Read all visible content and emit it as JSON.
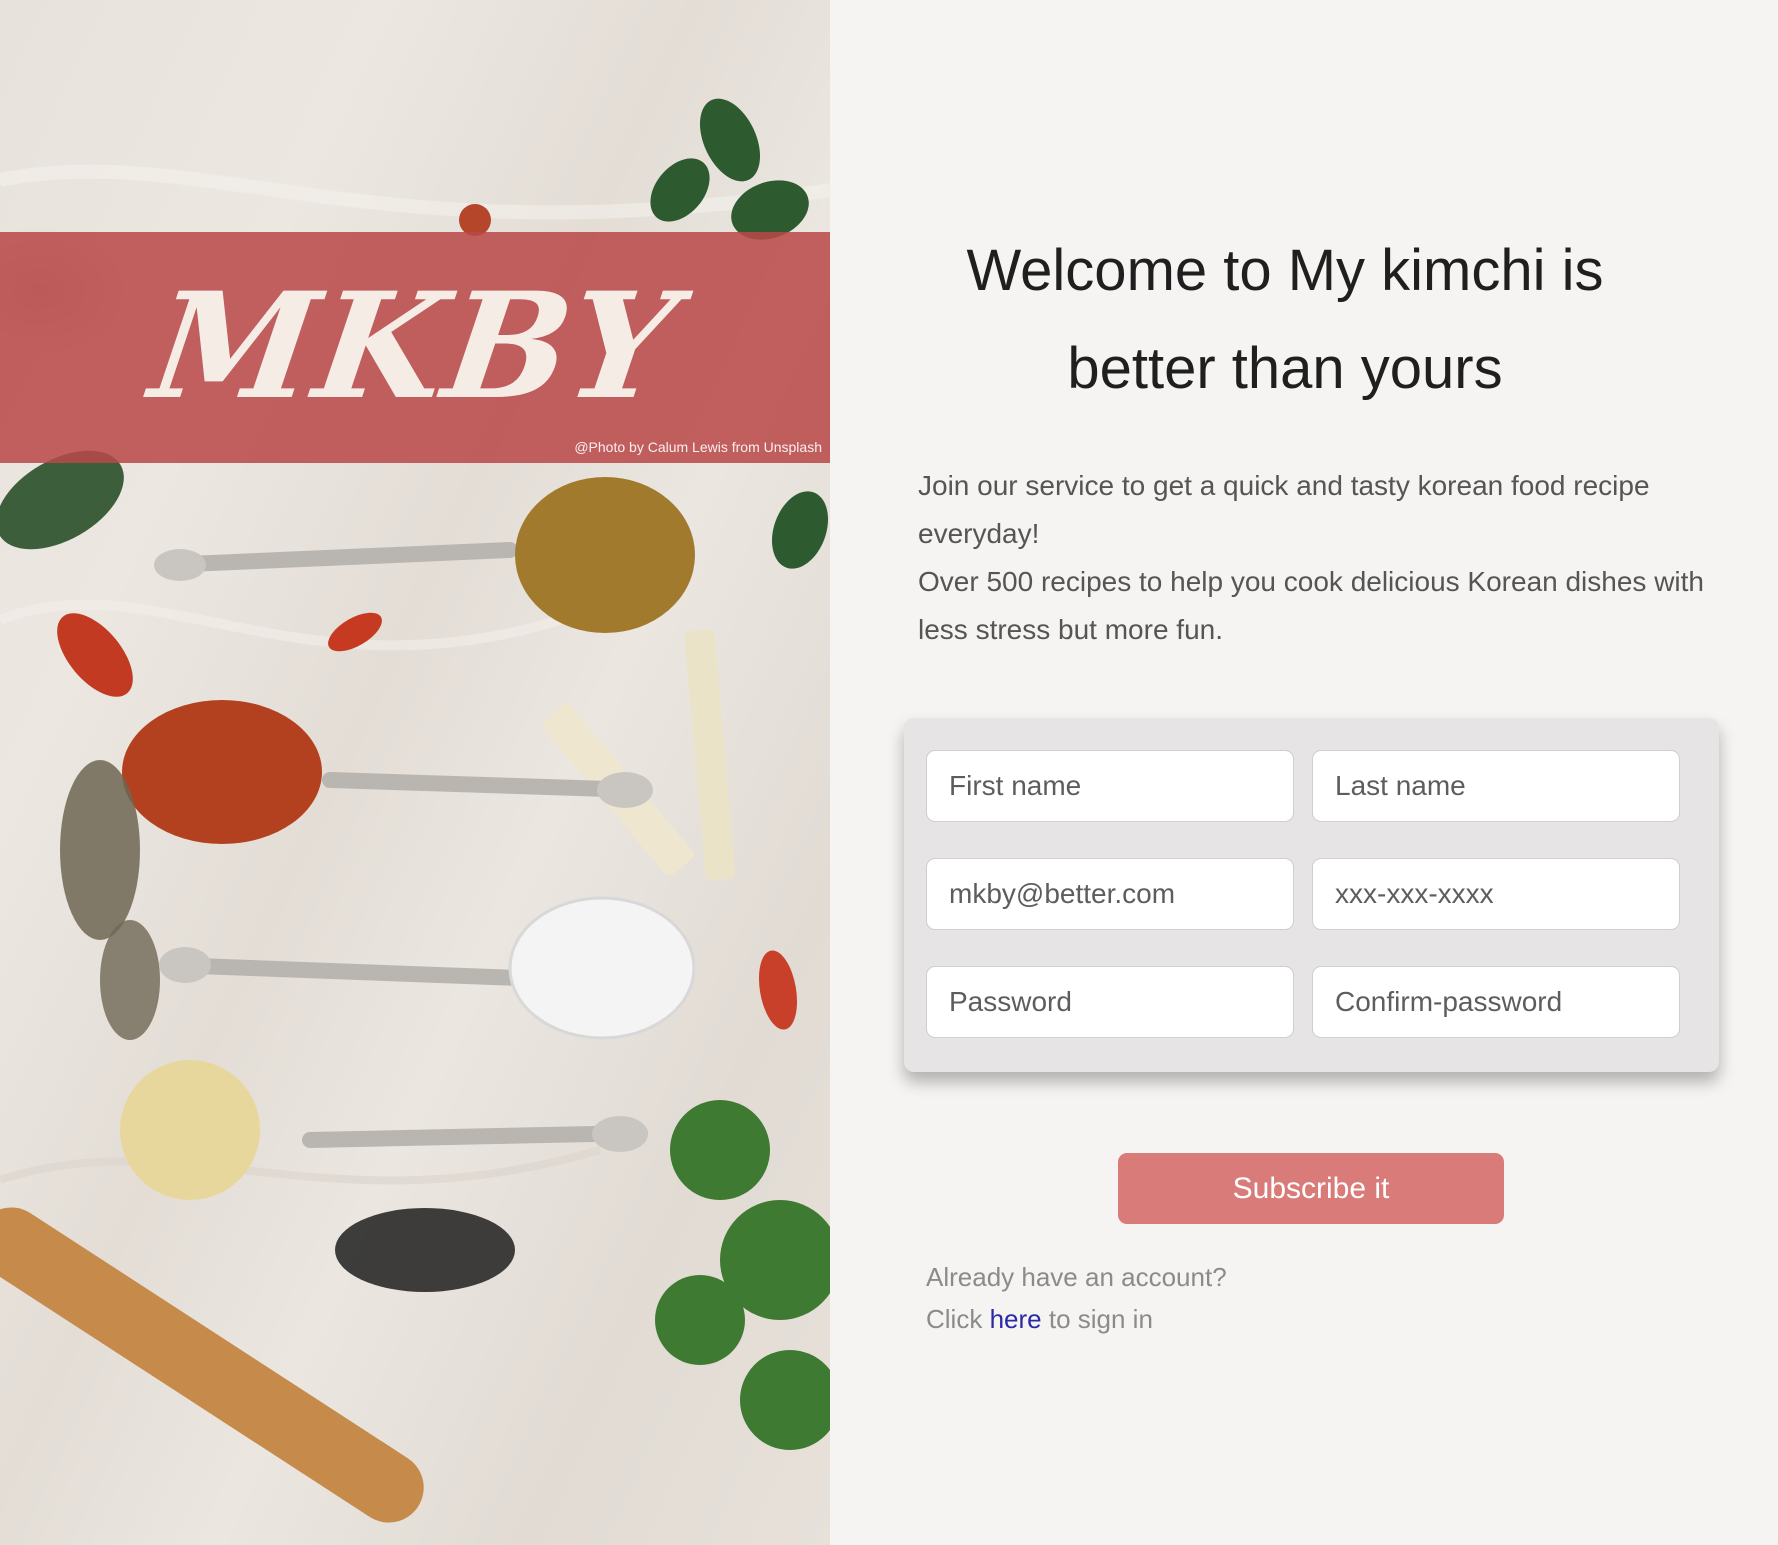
{
  "hero": {
    "logo_text": "MKBY",
    "photo_credit": "@Photo by Calum Lewis from Unsplash"
  },
  "welcome": {
    "title": "Welcome to My kimchi is better than yours",
    "intro_line_1": "Join our service to get a quick and tasty korean food recipe everyday!",
    "intro_line_2": "Over 500 recipes to help you cook delicious Korean dishes with less stress but more fun."
  },
  "form": {
    "first_name_placeholder": "First name",
    "last_name_placeholder": "Last name",
    "email_placeholder": "mkby@better.com",
    "phone_placeholder": "xxx-xxx-xxxx",
    "password_placeholder": "Password",
    "confirm_password_placeholder": "Confirm-password"
  },
  "actions": {
    "subscribe_label": "Subscribe it",
    "signin_prompt": "Already have an account?",
    "signin_prefix": "Click",
    "signin_link": "here",
    "signin_suffix": "to sign in"
  },
  "colors": {
    "banner": "#b94848",
    "button": "#d97b78",
    "background": "#f5f4f2",
    "link": "#2a2aa8"
  }
}
